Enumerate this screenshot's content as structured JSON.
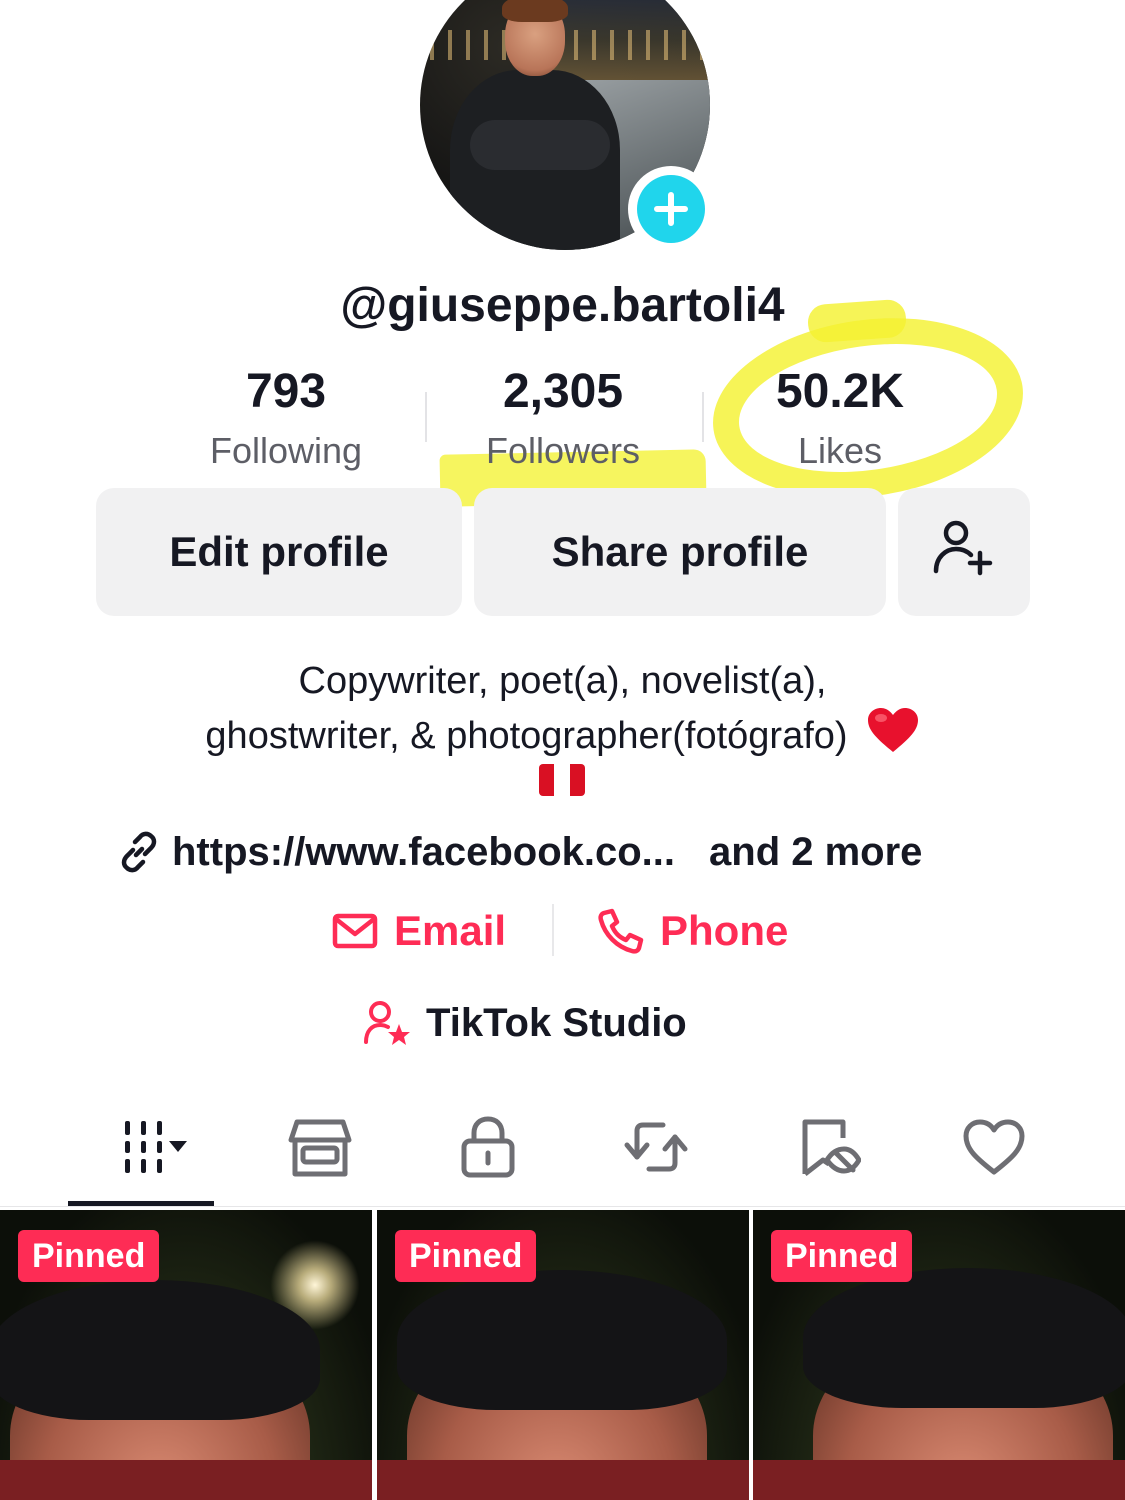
{
  "profile": {
    "username": "@giuseppe.bartoli4"
  },
  "stats": [
    {
      "value": "793",
      "label": "Following"
    },
    {
      "value": "2,305",
      "label": "Followers"
    },
    {
      "value": "50.2K",
      "label": "Likes"
    }
  ],
  "actions": {
    "edit_label": "Edit profile",
    "share_label": "Share profile"
  },
  "bio": {
    "line1": "Copywriter, poet(a), novelist(a),",
    "line2": "ghostwriter, & photographer(fotógrafo)"
  },
  "links": {
    "url": "https://www.facebook.co...",
    "more": "and 2 more"
  },
  "contact": {
    "email_label": "Email",
    "phone_label": "Phone"
  },
  "studio_label": "TikTok Studio",
  "tabs": [
    {
      "icon": "videos-grid-icon",
      "active": true
    },
    {
      "icon": "shop-icon"
    },
    {
      "icon": "lock-icon"
    },
    {
      "icon": "repost-icon"
    },
    {
      "icon": "hidden-bookmark-icon"
    },
    {
      "icon": "heart-icon"
    }
  ],
  "videos": [
    {
      "badge": "Pinned"
    },
    {
      "badge": "Pinned"
    },
    {
      "badge": "Pinned"
    }
  ],
  "colors": {
    "accent": "#fe2c55",
    "avatar_add": "#20d5ec",
    "highlighter": "#f4f232",
    "button_bg": "#f1f1f2"
  }
}
